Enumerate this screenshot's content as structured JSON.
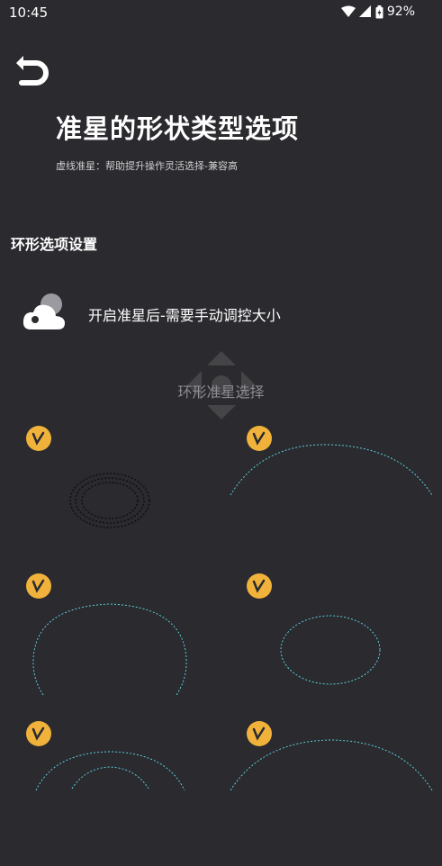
{
  "status": {
    "time": "10:45",
    "battery": "92%"
  },
  "header": {
    "title": "准星的形状类型选项",
    "subtitle": "虚线准星：帮助提升操作灵活选择-兼容高"
  },
  "section": {
    "title": "环形选项设置"
  },
  "setting": {
    "label": "开启准星后-需要手动调控大小"
  },
  "ring": {
    "label": "环形准星选择"
  },
  "colors": {
    "background": "#2a2a2f",
    "badge": "#f0b23a",
    "dash_cyan": "#5ccfd8",
    "dash_dark": "#111111"
  },
  "options": [
    {
      "id": "ring-1"
    },
    {
      "id": "ring-2"
    },
    {
      "id": "ring-3"
    },
    {
      "id": "ring-4"
    },
    {
      "id": "ring-5"
    },
    {
      "id": "ring-6"
    }
  ]
}
